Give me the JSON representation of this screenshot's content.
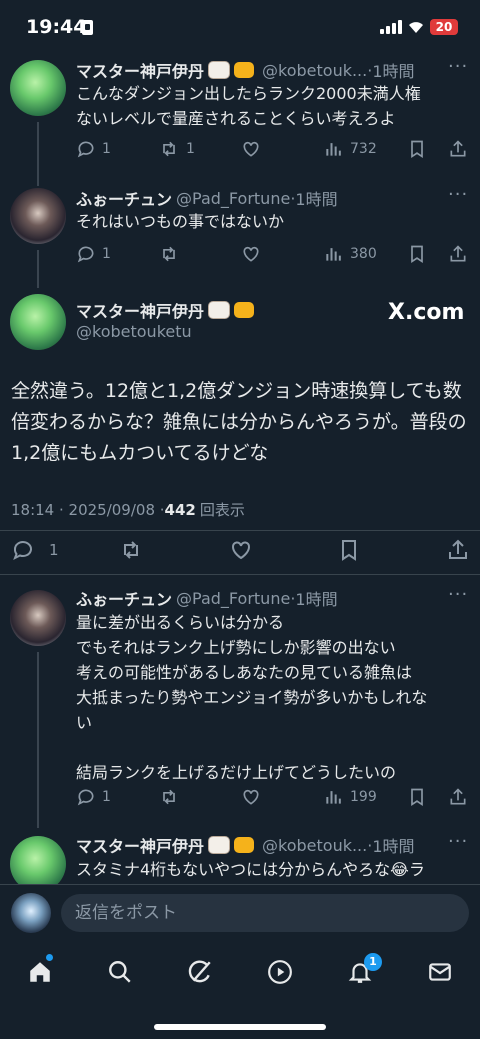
{
  "status": {
    "time": "19:44",
    "battery": "20"
  },
  "tweets": [
    {
      "name": "マスター神戸伊丹",
      "handle": "@kobetouk...",
      "time": "1時間",
      "text": "こんなダンジョン出したらランク2000未満人権\nないレベルで量産されることくらい考えろよ",
      "replies": "1",
      "retweets": "1",
      "likes": "",
      "views": "732"
    },
    {
      "name": "ふぉーチュン",
      "handle": "@Pad_Fortune",
      "time": "1時間",
      "text": "それはいつもの事ではないか",
      "replies": "1",
      "retweets": "",
      "likes": "",
      "views": "380"
    }
  ],
  "main": {
    "name": "マスター神戸伊丹",
    "handle": "@kobetouketu",
    "watermark": "X.com",
    "text": "全然違う。12億と1,2億ダンジョン時速換算しても数倍変わるからな？雑魚には分からんやろうが。普段の1,2億にもムカついてるけどな",
    "datetime": "18:14 · 2025/09/08 · ",
    "views": "442",
    "views_label": "回表示",
    "replies": "1"
  },
  "replies_list": [
    {
      "name": "ふぉーチュン",
      "handle": "@Pad_Fortune",
      "time": "1時間",
      "text": "量に差が出るくらいは分かる\nでもそれはランク上げ勢にしか影響の出ない\n考えの可能性があるしあなたの見ている雑魚は\n大抵まったり勢やエンジョイ勢が多いかもしれな\nい\n\n結局ランクを上げるだけ上げてどうしたいの",
      "replies": "1",
      "retweets": "",
      "likes": "",
      "views": "199"
    },
    {
      "name": "マスター神戸伊丹",
      "handle": "@kobetouk...",
      "time": "1時間",
      "text": "スタミナ4桁もないやつには分からんやろな😂ラ"
    }
  ],
  "reply_bar": {
    "placeholder": "返信をポスト"
  },
  "tabbar": {
    "notifications_badge": "1"
  },
  "dot": "·",
  "more": "···"
}
